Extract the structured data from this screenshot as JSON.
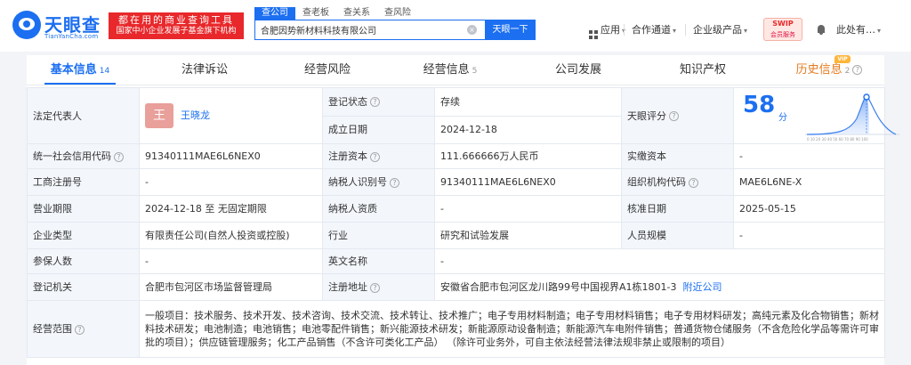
{
  "brand": {
    "name": "天眼查",
    "site": "TianYanCha.com",
    "slogan_line1": "都在用的商业查询工具",
    "slogan_line2": "国家中小企业发展子基金旗下机构"
  },
  "search": {
    "tabs": [
      "查公司",
      "查老板",
      "查关系",
      "查风险"
    ],
    "active_tab": 0,
    "value": "合肥因势新材料科技有限公司",
    "clear": "×",
    "button": "天眼一下"
  },
  "header_nav": {
    "apps": "应用",
    "partner": "合作通道",
    "enterprise": "企业级产品",
    "swip_title": "SWIP",
    "swip_sub": "会员服务",
    "user": "此处有…"
  },
  "icons": {
    "logo": "tianyancha-eye-logo",
    "clear": "clear-icon",
    "apps": "apps-icon",
    "bell": "bell-icon",
    "help": "help-circle-icon"
  },
  "content_tabs": [
    {
      "label": "基本信息",
      "count": "14"
    },
    {
      "label": "法律诉讼",
      "count": ""
    },
    {
      "label": "经营风险",
      "count": ""
    },
    {
      "label": "经营信息",
      "count": "5"
    },
    {
      "label": "公司发展",
      "count": ""
    },
    {
      "label": "知识产权",
      "count": ""
    },
    {
      "label": "历史信息",
      "count": "2"
    }
  ],
  "vip_badge": "VIP",
  "info": {
    "legal_rep_label": "法定代表人",
    "legal_rep_avatar": "王",
    "legal_rep_name": "王晓龙",
    "reg_status_label": "登记状态",
    "reg_status": "存续",
    "est_date_label": "成立日期",
    "est_date": "2024-12-18",
    "score_label": "天眼评分",
    "score": "58",
    "score_unit": "分",
    "credit_code_label": "统一社会信用代码",
    "credit_code": "91340111MAE6L6NEX0",
    "reg_capital_label": "注册资本",
    "reg_capital": "111.666666万人民币",
    "paid_capital_label": "实缴资本",
    "paid_capital": "-",
    "biz_reg_no_label": "工商注册号",
    "biz_reg_no": "-",
    "taxpayer_id_label": "纳税人识别号",
    "taxpayer_id": "91340111MAE6L6NEX0",
    "org_code_label": "组织机构代码",
    "org_code": "MAE6L6NE-X",
    "biz_term_label": "营业期限",
    "biz_term": "2024-12-18 至 无固定期限",
    "taxpayer_qual_label": "纳税人资质",
    "taxpayer_qual": "-",
    "approval_date_label": "核准日期",
    "approval_date": "2025-05-15",
    "company_type_label": "企业类型",
    "company_type": "有限责任公司(自然人投资或控股)",
    "industry_label": "行业",
    "industry": "研究和试验发展",
    "staff_size_label": "人员规模",
    "staff_size": "-",
    "insured_label": "参保人数",
    "insured": "-",
    "english_name_label": "英文名称",
    "english_name": "-",
    "reg_authority_label": "登记机关",
    "reg_authority": "合肥市包河区市场监督管理局",
    "reg_address_label": "注册地址",
    "reg_address": "安徽省合肥市包河区龙川路99号中国视界A1栋1801-3",
    "nearby_link": "附近公司",
    "scope_label": "经营范围",
    "scope": "一般项目：技术服务、技术开发、技术咨询、技术交流、技术转让、技术推广；电子专用材料制造；电子专用材料销售；电子专用材料研发；高纯元素及化合物销售；新材料技术研发；电池制造；电池销售；电池零配件销售；新兴能源技术研发；新能源原动设备制造；新能源汽车电附件销售；普通货物仓储服务（不含危险化学品等需许可审批的项目）；供应链管理服务；化工产品销售（不含许可类化工产品） （除许可业务外，可自主依法经营法律法规非禁止或限制的项目）"
  },
  "colors": {
    "brand_blue": "#1c6ff0",
    "slogan_red": "#e8282b",
    "status_green": "#1c9c5a",
    "history_orange": "#e67a1e"
  }
}
